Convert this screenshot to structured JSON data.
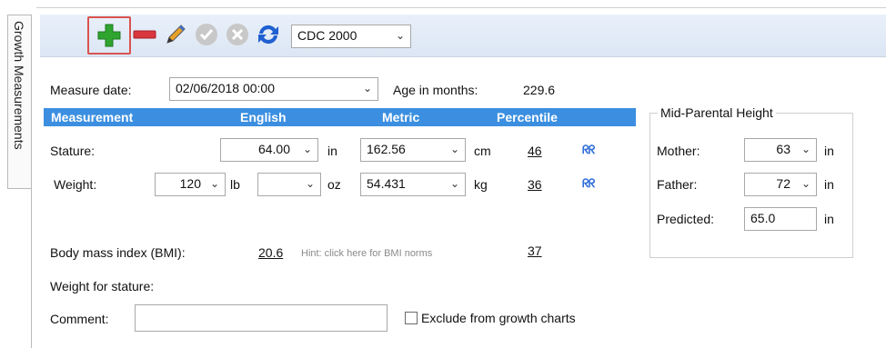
{
  "tab": {
    "label": "Growth Measurements"
  },
  "toolbar": {
    "chart_standard": "CDC 2000"
  },
  "measure": {
    "date_label": "Measure date:",
    "date_value": "02/06/2018 00:00",
    "age_label": "Age in months:",
    "age_value": "229.6"
  },
  "table": {
    "headers": {
      "measurement": "Measurement",
      "english": "English",
      "metric": "Metric",
      "percentile": "Percentile"
    },
    "stature": {
      "label": "Stature:",
      "english_value": "64.00",
      "english_unit": "in",
      "metric_value": "162.56",
      "metric_unit": "cm",
      "percentile": "46"
    },
    "weight": {
      "label": "Weight:",
      "lb_value": "120",
      "lb_unit": "lb",
      "oz_value": "",
      "oz_unit": "oz",
      "metric_value": "54.431",
      "metric_unit": "kg",
      "percentile": "36"
    }
  },
  "bmi": {
    "label": "Body mass index (BMI):",
    "value": "20.6",
    "hint": "Hint: click here for BMI norms",
    "percentile": "37"
  },
  "weight_for_stature": {
    "label": "Weight for stature:"
  },
  "comment": {
    "label": "Comment:",
    "value": ""
  },
  "exclude": {
    "label": "Exclude from growth charts"
  },
  "mid_parental": {
    "title": "Mid-Parental Height",
    "mother_label": "Mother:",
    "mother_value": "63",
    "mother_unit": "in",
    "father_label": "Father:",
    "father_value": "72",
    "father_unit": "in",
    "predicted_label": "Predicted:",
    "predicted_value": "65.0",
    "predicted_unit": "in"
  },
  "icons": {
    "trend": "ᖇᖇ"
  },
  "colors": {
    "header_bar": "#3c8fe0",
    "add_green": "#2fa52f",
    "remove_red": "#d9363e",
    "refresh_blue": "#1f5fd0"
  }
}
